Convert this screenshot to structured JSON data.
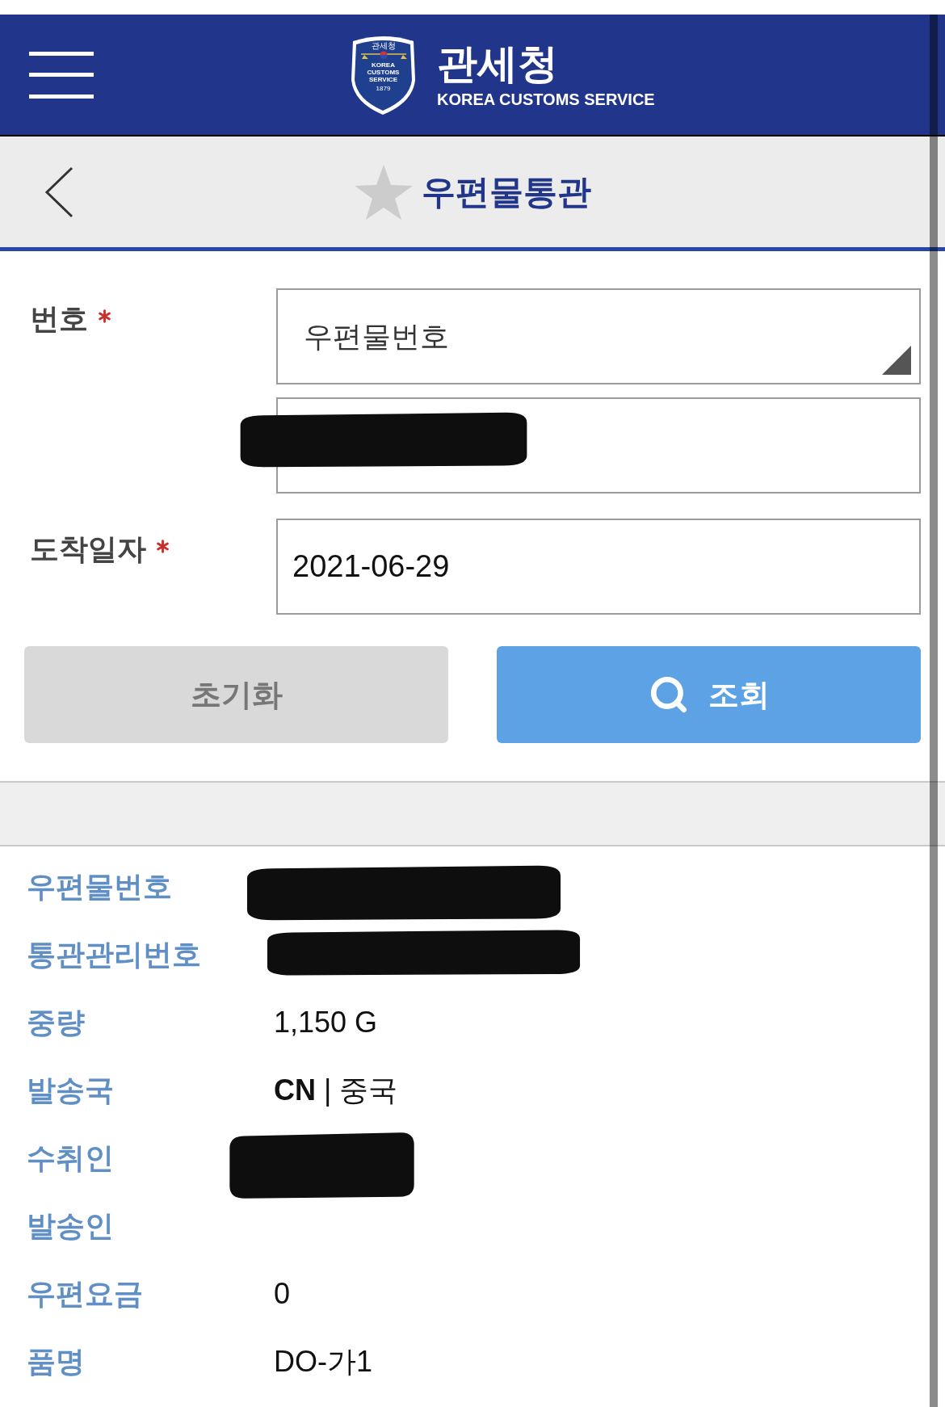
{
  "header": {
    "logo": {
      "emblem_lines": [
        "관세청",
        "KOREA",
        "CUSTOMS",
        "SERVICE",
        "1879"
      ],
      "title": "관세청",
      "subtitle": "KOREA CUSTOMS SERVICE"
    }
  },
  "page_bar": {
    "title": "우편물통관",
    "favorite": false
  },
  "form": {
    "fields": [
      {
        "kind": "select",
        "label": "번호",
        "required": true,
        "value": "우편물번호",
        "redacted": false
      },
      {
        "kind": "text",
        "required": false,
        "redacted": true
      },
      {
        "kind": "text",
        "label": "도착일자",
        "required": true,
        "value": "2021-06-29",
        "redacted": false
      }
    ],
    "buttons": [
      {
        "kind": "reset",
        "label": "초기화"
      },
      {
        "kind": "search",
        "label": "조회"
      }
    ]
  },
  "results": [
    {
      "label": "우편물번호",
      "redacted": true
    },
    {
      "label": "통관관리번호",
      "redacted": true
    },
    {
      "label": "중량",
      "value": "1,150 G",
      "redacted": false
    },
    {
      "label": "발송국",
      "value": "**CN** | 중국",
      "redacted": false
    },
    {
      "label": "수취인",
      "redacted": true
    },
    {
      "label": "발송인",
      "redacted": false
    },
    {
      "label": "우편요금",
      "value": "0",
      "redacted": false
    },
    {
      "label": "품명",
      "value": "DO-가1",
      "redacted": false
    }
  ]
}
